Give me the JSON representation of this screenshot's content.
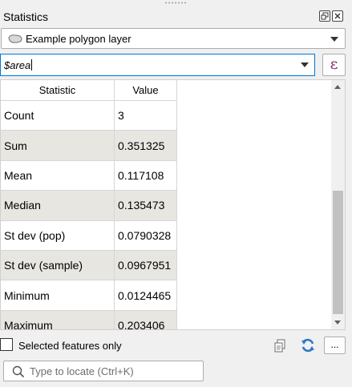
{
  "panel": {
    "title": "Statistics"
  },
  "layer_selector": {
    "value": "Example polygon layer"
  },
  "expression": {
    "value": "$area",
    "epsilon_label": "ε"
  },
  "table": {
    "headers": {
      "statistic": "Statistic",
      "value": "Value"
    },
    "rows": [
      {
        "statistic": "Count",
        "value": "3"
      },
      {
        "statistic": "Sum",
        "value": "0.351325"
      },
      {
        "statistic": "Mean",
        "value": "0.117108"
      },
      {
        "statistic": "Median",
        "value": "0.135473"
      },
      {
        "statistic": "St dev (pop)",
        "value": "0.0790328"
      },
      {
        "statistic": "St dev (sample)",
        "value": "0.0967951"
      },
      {
        "statistic": "Minimum",
        "value": "0.0124465"
      },
      {
        "statistic": "Maximum",
        "value": "0.203406"
      }
    ]
  },
  "footer": {
    "selected_only_label": "Selected features only",
    "more_label": "...",
    "locator_placeholder": "Type to locate (Ctrl+K)"
  },
  "icons": {
    "float": "float-icon",
    "close": "close-icon",
    "polygon": "polygon-layer-icon",
    "copy": "copy-icon",
    "refresh": "refresh-icon",
    "search": "search-icon"
  },
  "colors": {
    "accent": "#0078d7",
    "alt_row": "#e8e6e1",
    "epsilon": "#8a2b6b",
    "refresh": "#2b78c2"
  }
}
